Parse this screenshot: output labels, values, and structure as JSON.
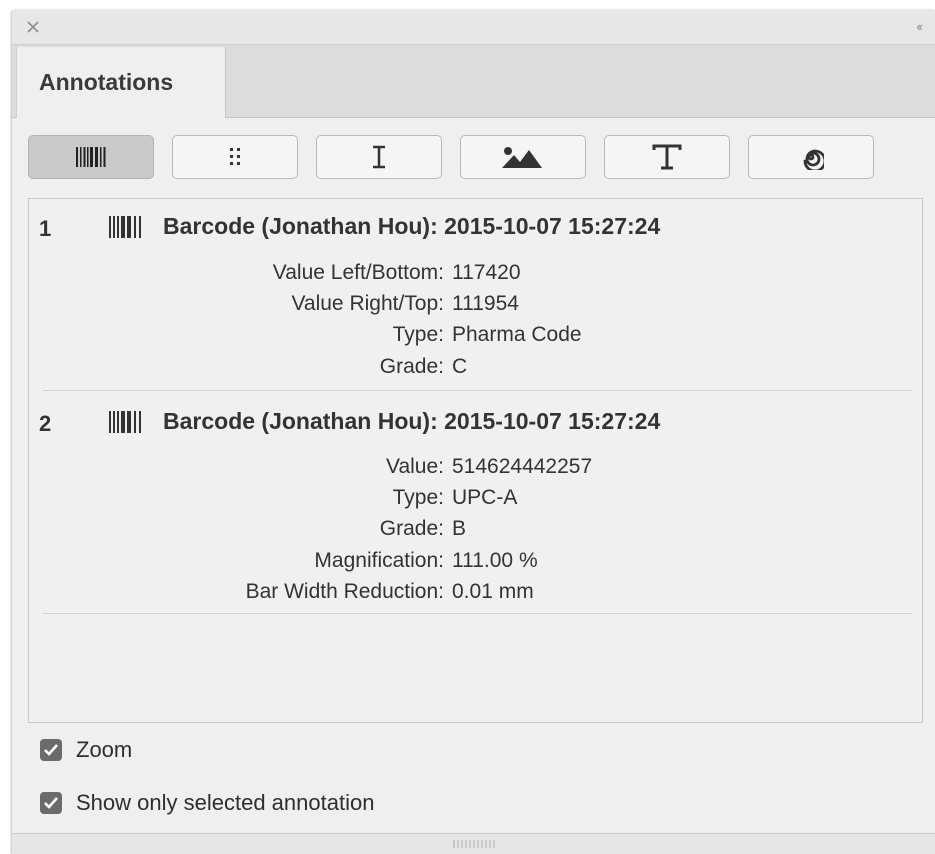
{
  "panel": {
    "tab_label": "Annotations",
    "collapse_glyph": "‹‹"
  },
  "toolbar": {
    "buttons": [
      {
        "name": "barcode-tool-button",
        "icon": "barcode-icon",
        "active": true
      },
      {
        "name": "dots-tool-button",
        "icon": "dot-grid-icon",
        "active": false
      },
      {
        "name": "text-cursor-tool-button",
        "icon": "text-cursor-icon",
        "active": false
      },
      {
        "name": "image-tool-button",
        "icon": "image-icon",
        "active": false
      },
      {
        "name": "text-tool-button",
        "icon": "text-t-icon",
        "active": false
      },
      {
        "name": "spiral-tool-button",
        "icon": "spiral-icon",
        "active": false
      }
    ]
  },
  "annotations": [
    {
      "number": "1",
      "title": "Barcode (Jonathan Hou): 2015-10-07 15:27:24",
      "props": [
        {
          "label": "Value Left/Bottom:",
          "value": "117420"
        },
        {
          "label": "Value Right/Top:",
          "value": "111954"
        },
        {
          "label": "Type:",
          "value": "Pharma Code"
        },
        {
          "label": "Grade:",
          "value": "C"
        }
      ]
    },
    {
      "number": "2",
      "title": "Barcode (Jonathan Hou): 2015-10-07 15:27:24",
      "props": [
        {
          "label": "Value:",
          "value": "514624442257"
        },
        {
          "label": "Type:",
          "value": "UPC-A"
        },
        {
          "label": "Grade:",
          "value": "B"
        },
        {
          "label": "Magnification:",
          "value": "111.00 %"
        },
        {
          "label": "Bar Width Reduction:",
          "value": "0.01 mm"
        }
      ]
    }
  ],
  "options": {
    "zoom_label": "Zoom",
    "zoom_checked": true,
    "show_selected_label": "Show only selected annotation",
    "show_selected_checked": true
  },
  "colors": {
    "panel_bg": "#efefef",
    "checkbox": "#6b6b6b"
  }
}
